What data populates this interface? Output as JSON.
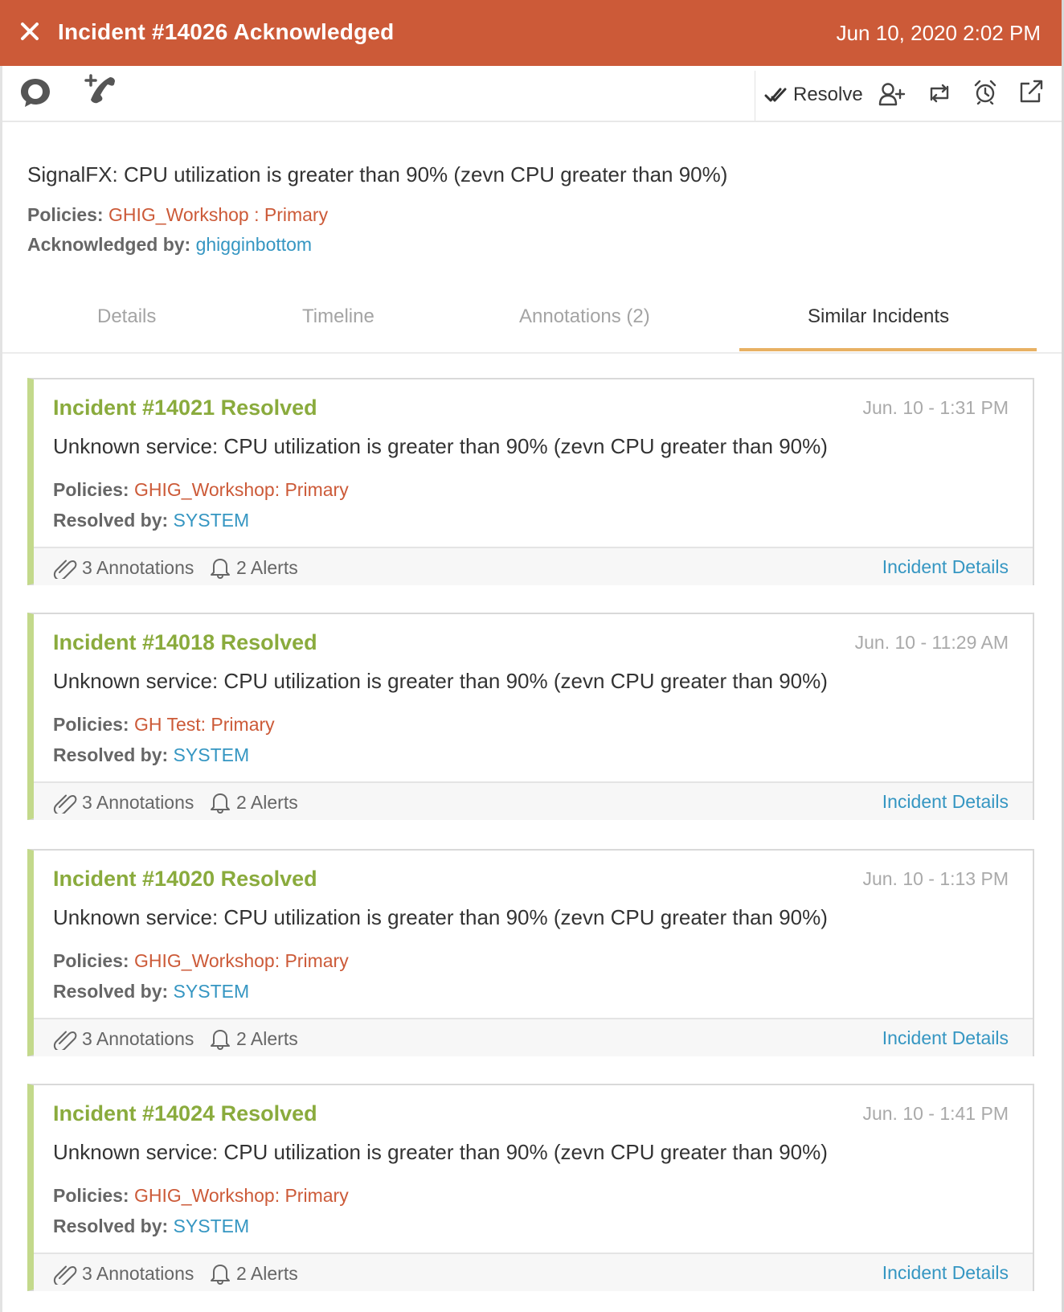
{
  "header": {
    "title": "Incident #14026 Acknowledged",
    "datetime": "Jun 10, 2020 2:02 PM",
    "background_color": "#cc5a38"
  },
  "toolbar": {
    "left_icons": [
      "chat-bubble-icon",
      "add-phone-icon"
    ],
    "resolve_label": "Resolve",
    "right_icons": [
      "add-user-icon",
      "reroute-icon",
      "snooze-alarm-icon",
      "external-link-icon"
    ]
  },
  "incident": {
    "summary": "SignalFX: CPU utilization is greater than 90% (zevn CPU greater than 90%)",
    "policies_label": "Policies:",
    "policies_value": "GHIG_Workshop : Primary",
    "acknowledged_label": "Acknowledged by:",
    "acknowledged_value": "ghigginbottom"
  },
  "tabs": [
    {
      "label": "Details",
      "active": false
    },
    {
      "label": "Timeline",
      "active": false
    },
    {
      "label": "Annotations (2)",
      "active": false
    },
    {
      "label": "Similar Incidents",
      "active": true
    }
  ],
  "labels": {
    "policies": "Policies:",
    "resolved_by": "Resolved by:",
    "incident_details": "Incident Details"
  },
  "similar_incidents": [
    {
      "title": "Incident #14021 Resolved",
      "time": "Jun. 10 - 1:31 PM",
      "description": "Unknown service: CPU utilization is greater than 90% (zevn CPU greater than 90%)",
      "policy": "GHIG_Workshop: Primary",
      "resolved_by": "SYSTEM",
      "annotations": "3 Annotations",
      "alerts": "2 Alerts"
    },
    {
      "title": "Incident #14018 Resolved",
      "time": "Jun. 10 - 11:29 AM",
      "description": "Unknown service: CPU utilization is greater than 90% (zevn CPU greater than 90%)",
      "policy": "GH Test: Primary",
      "resolved_by": "SYSTEM",
      "annotations": "3 Annotations",
      "alerts": "2 Alerts"
    },
    {
      "title": "Incident #14020 Resolved",
      "time": "Jun. 10 - 1:13 PM",
      "description": "Unknown service: CPU utilization is greater than 90% (zevn CPU greater than 90%)",
      "policy": "GHIG_Workshop: Primary",
      "resolved_by": "SYSTEM",
      "annotations": "3 Annotations",
      "alerts": "2 Alerts"
    },
    {
      "title": "Incident #14024 Resolved",
      "time": "Jun. 10 - 1:41 PM",
      "description": "Unknown service: CPU utilization is greater than 90% (zevn CPU greater than 90%)",
      "policy": "GHIG_Workshop: Primary",
      "resolved_by": "SYSTEM",
      "annotations": "3 Annotations",
      "alerts": "2 Alerts"
    }
  ]
}
